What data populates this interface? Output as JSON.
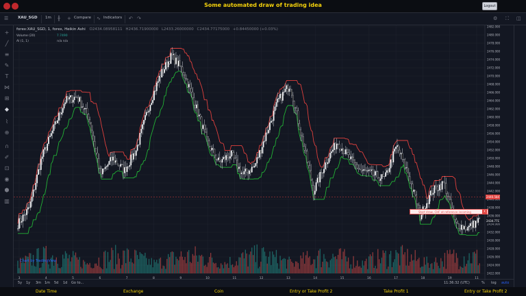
{
  "app": {
    "title": "Some automated draw of trading idea",
    "logout_label": "Logout"
  },
  "toolbar": {
    "symbol": "XAU_SGD",
    "interval": "1m",
    "compare": "Compare",
    "indicators": "Indicators"
  },
  "legend": {
    "main": "forex:XAU_SGD, 1, forex, Heikin Ashi",
    "open": "O2434.08958111",
    "high": "H2436.71900000",
    "low": "L2433.26000000",
    "close": "C2434.77175000",
    "change": "+0.84450000 (+0.03%)",
    "volume_label": "Volume (20)",
    "volume_value": "7.7490",
    "al_label": "Al (1, 1)",
    "al_values": "n/a  n/a"
  },
  "watermark": "Chart by TradingView",
  "annotation": {
    "text": "Start draw, CHF at reference incoming",
    "close": "X"
  },
  "price_badge": {
    "value": "2440.58476576",
    "color": "#e0403d"
  },
  "last_price": {
    "value": "2434.77175000",
    "color": "#ffffff"
  },
  "colors": {
    "bull": "#26a69a",
    "bear": "#ef5350",
    "candle_up": "#ffffff",
    "candle_down": "#111111",
    "upper_band": "#e0403d",
    "lower_band": "#22b335",
    "accent": "#f5d20b"
  },
  "bottom": {
    "ranges": [
      "5y",
      "1y",
      "3m",
      "1m",
      "5d",
      "1d",
      "Go to..."
    ],
    "time": "11:36:32 (UTC)",
    "pct": "%",
    "log": "log",
    "auto": "auto"
  },
  "footer_labels": [
    "Date Time",
    "Exchange",
    "Coin",
    "Entry or Take Profit 2",
    "Take Profit 1",
    "Entry or Take Profit 2"
  ],
  "chart_data": {
    "type": "candlestick",
    "x_ticks": [
      "3",
      "4",
      "5",
      "6",
      "7",
      "8",
      "9",
      "10",
      "11",
      "12",
      "13",
      "14",
      "15",
      "16",
      "17",
      "18",
      "19",
      "11"
    ],
    "y_ticks": [
      2482,
      2480,
      2478,
      2476,
      2474,
      2472,
      2470,
      2468,
      2466,
      2464,
      2462,
      2460,
      2458,
      2456,
      2454,
      2452,
      2450,
      2448,
      2446,
      2444,
      2442,
      2440,
      2438,
      2436,
      2434,
      2432,
      2430,
      2428,
      2426,
      2424,
      2422
    ],
    "y_tick_suffix": ".00000000",
    "ylim": [
      2422,
      2482
    ],
    "price_path_anchors": [
      2434,
      2438,
      2450,
      2457,
      2464,
      2465,
      2460,
      2446,
      2450,
      2447,
      2452,
      2462,
      2470,
      2475,
      2471,
      2463,
      2454,
      2449,
      2451,
      2446,
      2448,
      2456,
      2464,
      2468,
      2455,
      2442,
      2449,
      2454,
      2450,
      2447,
      2446,
      2445,
      2453,
      2446,
      2436,
      2442,
      2444,
      2434,
      2433,
      2435
    ]
  }
}
